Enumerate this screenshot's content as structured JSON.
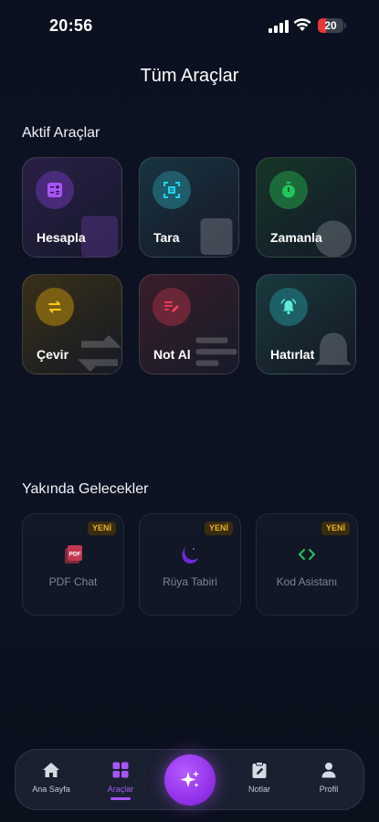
{
  "status_bar": {
    "time": "20:56",
    "battery": "20"
  },
  "page": {
    "title": "Tüm Araçlar"
  },
  "active_tools": {
    "title": "Aktif Araçlar",
    "items": [
      {
        "label": "Hesapla",
        "icon": "calculator-icon",
        "color": "#a855f7"
      },
      {
        "label": "Tara",
        "icon": "scan-icon",
        "color": "#22d3ee"
      },
      {
        "label": "Zamanla",
        "icon": "timer-icon",
        "color": "#22c55e"
      },
      {
        "label": "Çevir",
        "icon": "swap-icon",
        "color": "#eab308"
      },
      {
        "label": "Not Al",
        "icon": "note-edit-icon",
        "color": "#f43f5e"
      },
      {
        "label": "Hatırlat",
        "icon": "bell-alarm-icon",
        "color": "#2dd4bf"
      }
    ]
  },
  "coming_soon": {
    "title": "Yakında Gelecekler",
    "items": [
      {
        "label": "PDF Chat",
        "badge": "YENİ",
        "icon": "pdf-icon",
        "color": "#f43f5e"
      },
      {
        "label": "Rüya Tabiri",
        "badge": "YENİ",
        "icon": "moon-icon",
        "color": "#7c3aed"
      },
      {
        "label": "Kod Asistanı",
        "badge": "YENİ",
        "icon": "code-icon",
        "color": "#22c55e"
      }
    ]
  },
  "tab_bar": {
    "active": "Araçlar",
    "items": [
      {
        "label": "Ana Sayfa",
        "icon": "home-icon"
      },
      {
        "label": "Araçlar",
        "icon": "grid-icon"
      },
      {
        "label": "",
        "icon": "sparkle-icon"
      },
      {
        "label": "Notlar",
        "icon": "notes-icon"
      },
      {
        "label": "Profil",
        "icon": "profile-icon"
      }
    ]
  },
  "colors": {
    "accent": "#a855f7",
    "background": "#0b1120",
    "badge": "#e8b22c"
  }
}
